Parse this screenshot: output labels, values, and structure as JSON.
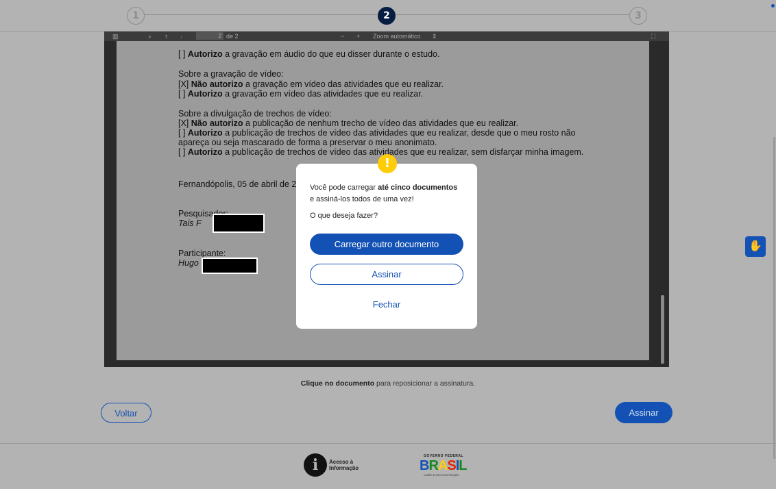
{
  "stepper": {
    "steps": [
      "1",
      "2",
      "3"
    ],
    "current_step": 2
  },
  "pdf_toolbar": {
    "page_current": "2",
    "page_total": "de 2",
    "zoom_out": "−",
    "zoom_in": "+",
    "zoom_label": "Zoom automático",
    "zoom_arrow": "⇕",
    "sidebar_icon": "sidebar-toggle-icon",
    "search_icon": "search-icon",
    "prev_icon": "arrow-up-icon",
    "next_icon": "arrow-down-icon",
    "tools_icon": "presentation-mode-icon"
  },
  "document": {
    "audio_authorize": {
      "prefix": "[ ] ",
      "bold": "Autorizo",
      "rest": " a gravação em áudio do que eu disser durante o estudo."
    },
    "video_heading": "Sobre a gravação de vídeo:",
    "video_no": {
      "prefix": "[X] ",
      "bold": "Não autorizo",
      "rest": " a gravação em vídeo das atividades que eu realizar."
    },
    "video_yes": {
      "prefix": "[ ] ",
      "bold": "Autorizo",
      "rest": " a gravação em vídeo das atividades que eu realizar."
    },
    "clips_heading": "Sobre a divulgação de trechos de vídeo:",
    "clips_no": {
      "prefix": "[X] ",
      "bold": "Não autorizo",
      "rest": " a publicação de nenhum trecho de vídeo das atividades que eu realizar."
    },
    "clips_masked_1": {
      "prefix": "[ ] ",
      "bold": "Autorizo",
      "rest": " a publicação de trechos de vídeo das atividades que eu realizar, desde que o meu rosto não"
    },
    "clips_masked_2": "apareça ou seja mascarado de forma a preservar o meu anonimato.",
    "clips_full": {
      "prefix": "[ ] ",
      "bold": "Autorizo",
      "rest": " a publicação de trechos de vídeo das atividades que eu realizar, sem disfarçar minha imagem."
    },
    "place_date": "Fernandópolis, 05 de abril de 2",
    "researcher_label": "Pesquisador:",
    "researcher_name": "Tais F",
    "participant_label": "Participante:",
    "participant_name": "Hugo"
  },
  "dialog": {
    "icon": "warning-icon",
    "icon_glyph": "!",
    "line1_prefix": "Você pode carregar ",
    "line1_bold": "até cinco documentos",
    "line2": "e assiná-los todos de uma vez!",
    "question": "O que deseja fazer?",
    "primary_button": "Carregar outro documento",
    "secondary_button": "Assinar",
    "close_link": "Fechar"
  },
  "hint": {
    "bold": "Clique no documento",
    "rest": " para reposicionar a assinatura."
  },
  "actions": {
    "back": "Voltar",
    "sign": "Assinar"
  },
  "footer": {
    "acesso_line1": "Acesso à",
    "acesso_line2": "Informação",
    "gov_top": "GOVERNO FEDERAL",
    "gov_logo": "BRASIL",
    "gov_bottom": "UNIÃO E RECONSTRUÇÃO"
  },
  "colors": {
    "primary": "#1351b4",
    "dark_step": "#071d41",
    "warning": "#ffcd07"
  }
}
